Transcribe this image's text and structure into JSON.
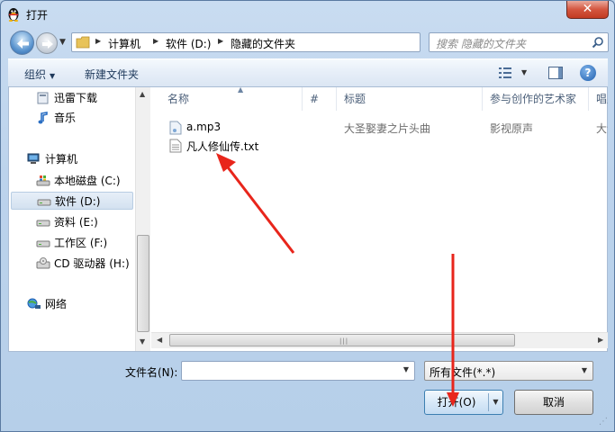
{
  "window": {
    "title": "打开",
    "close_glyph": "✕"
  },
  "address_bar": {
    "crumbs": [
      "计算机",
      "软件 (D:)",
      "隐藏的文件夹"
    ]
  },
  "search": {
    "placeholder": "搜索 隐藏的文件夹"
  },
  "toolbar": {
    "organize": "组织",
    "new_folder": "新建文件夹",
    "help": "?"
  },
  "nav": {
    "items": [
      {
        "label": "迅雷下载",
        "icon": "download-folder-icon"
      },
      {
        "label": "音乐",
        "icon": "music-icon"
      },
      {
        "label": "计算机",
        "icon": "computer-icon"
      },
      {
        "label": "本地磁盘 (C:)",
        "icon": "system-drive-icon"
      },
      {
        "label": "软件 (D:)",
        "icon": "drive-icon"
      },
      {
        "label": "资料 (E:)",
        "icon": "drive-icon"
      },
      {
        "label": "工作区 (F:)",
        "icon": "drive-icon"
      },
      {
        "label": "CD 驱动器 (H:)",
        "icon": "cd-drive-icon"
      },
      {
        "label": "网络",
        "icon": "network-icon"
      }
    ]
  },
  "columns": [
    "名称",
    "#",
    "标题",
    "参与创作的艺术家",
    "唱片"
  ],
  "files": [
    {
      "name": "a.mp3",
      "icon": "audio-file-icon",
      "number": "",
      "title": "大圣娶妻之片头曲",
      "artist": "影视原声",
      "album": "大话"
    },
    {
      "name": "凡人修仙传.txt",
      "icon": "text-file-icon",
      "number": "",
      "title": "",
      "artist": "",
      "album": ""
    }
  ],
  "bottom": {
    "filename_label": "文件名(N):",
    "filename_value": "",
    "filter": "所有文件(*.*)",
    "open": "打开(O)",
    "cancel": "取消"
  },
  "colors": {
    "accent": "#2b63a8",
    "annotation_arrow": "#e8251b"
  }
}
